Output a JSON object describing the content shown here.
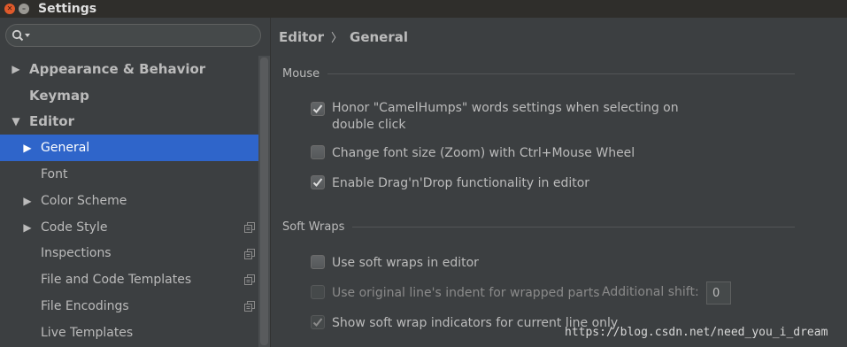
{
  "window": {
    "title": "Settings"
  },
  "search": {
    "placeholder": ""
  },
  "tree": {
    "appearance": "Appearance & Behavior",
    "keymap": "Keymap",
    "editor": "Editor",
    "general": "General",
    "font": "Font",
    "color_scheme": "Color Scheme",
    "code_style": "Code Style",
    "inspections": "Inspections",
    "file_code_templates": "File and Code Templates",
    "file_encodings": "File Encodings",
    "live_templates": "Live Templates"
  },
  "breadcrumb": {
    "parent": "Editor",
    "separator": "〉",
    "current": "General"
  },
  "mouse": {
    "title": "Mouse",
    "camelhumps_line1": "Honor \"CamelHumps\" words settings when selecting on",
    "camelhumps_line2": "double click",
    "camelhumps_checked": true,
    "zoom": "Change font size (Zoom) with Ctrl+Mouse Wheel",
    "zoom_checked": false,
    "dragdrop": "Enable Drag'n'Drop functionality in editor",
    "dragdrop_checked": true
  },
  "soft_wraps": {
    "title": "Soft Wraps",
    "use_soft_wraps": "Use soft wraps in editor",
    "use_soft_wraps_checked": false,
    "original_indent": "Use original line's indent for wrapped parts",
    "original_indent_checked": false,
    "additional_shift_label": "Additional shift:",
    "additional_shift_value": "0",
    "indicators": "Show soft wrap indicators for current line only",
    "indicators_checked": true
  },
  "watermark": "https://blog.csdn.net/need_you_i_dream",
  "colors": {
    "selection": "#2f65ca",
    "background": "#3c3f41",
    "text": "#bbbbbb",
    "close_button": "#e05a2b"
  }
}
